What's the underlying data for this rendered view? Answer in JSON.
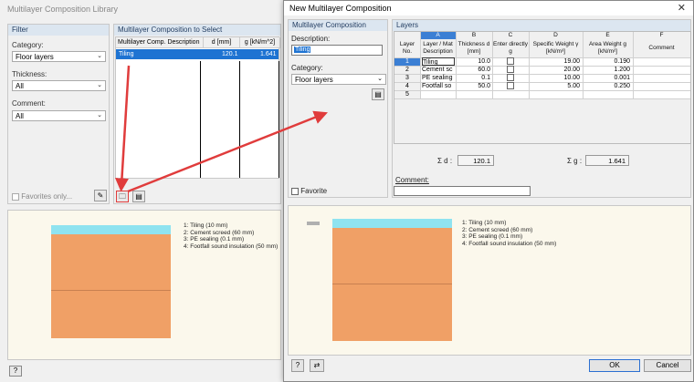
{
  "library": {
    "title": "Multilayer Composition Library",
    "filter": {
      "heading": "Filter",
      "category_label": "Category:",
      "category_value": "Floor layers",
      "thickness_label": "Thickness:",
      "thickness_value": "All",
      "comment_label": "Comment:",
      "comment_value": "All",
      "favorites_label": "Favorites only..."
    },
    "select": {
      "heading": "Multilayer Composition to Select",
      "columns": [
        "Multilayer Comp. Description",
        "d [mm]",
        "g [kN/m^2]"
      ],
      "row": {
        "description": "Tiling",
        "d": "120.1",
        "g": "1.641"
      }
    }
  },
  "dialog": {
    "title": "New Multilayer Composition",
    "close_glyph": "✕",
    "composition": {
      "heading": "Multilayer Composition",
      "description_label": "Description:",
      "description_value": "Tiling",
      "category_label": "Category:",
      "category_value": "Floor layers",
      "favorite_label": "Favorite"
    },
    "layers": {
      "heading": "Layers",
      "col_letters": [
        "A",
        "B",
        "C",
        "D",
        "E",
        "F"
      ],
      "headers": {
        "no": "Layer No.",
        "a": "Layer / Mat Description",
        "b": "Thickness d [mm]",
        "c": "Enter directly g",
        "d": "Specific Weight γ [kN/m³]",
        "e": "Area Weight g [kN/m²]",
        "f": "Comment"
      },
      "rows": [
        {
          "no": "1",
          "desc": "Tiling",
          "d": "10.0",
          "sw": "19.00",
          "aw": "0.190"
        },
        {
          "no": "2",
          "desc": "Cement sc",
          "d": "60.0",
          "sw": "20.00",
          "aw": "1.200"
        },
        {
          "no": "3",
          "desc": "PE sealing",
          "d": "0.1",
          "sw": "10.00",
          "aw": "0.001"
        },
        {
          "no": "4",
          "desc": "Footfall so",
          "d": "50.0",
          "sw": "5.00",
          "aw": "0.250"
        },
        {
          "no": "5",
          "desc": "",
          "d": "",
          "sw": "",
          "aw": ""
        }
      ],
      "sum_d_label": "Σ d :",
      "sum_d_value": "120.1",
      "sum_g_label": "Σ g :",
      "sum_g_value": "1.641",
      "comment_label": "Comment:"
    },
    "buttons": {
      "ok": "OK",
      "cancel": "Cancel"
    }
  },
  "legend": [
    "1: Tiling (10 mm)",
    "2: Cement screed (60 mm)",
    "3: PE sealing (0.1 mm)",
    "4: Footfall sound insulation (50 mm)"
  ],
  "colors": {
    "tiling": "#8fe3f0",
    "screed": "#f0a066",
    "arrow": "#e03c3c",
    "selection": "#1e73d2"
  }
}
